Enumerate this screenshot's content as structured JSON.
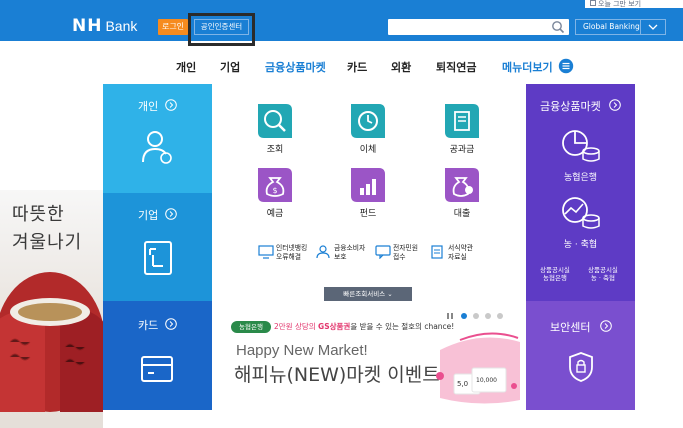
{
  "top_notice": {
    "label": "오늘 그만 보기"
  },
  "header": {
    "logo_nh": "NH",
    "logo_bank": "Bank",
    "login": "로그인",
    "cert_center": "공인인증센터",
    "search_placeholder": "",
    "global": "Global Banking"
  },
  "nav": {
    "items": [
      "개인",
      "기업",
      "금융상품마켓",
      "카드",
      "외환",
      "퇴직연금"
    ],
    "menu_label": "메뉴더보기"
  },
  "promo": {
    "line1": "따뜻한",
    "line2": "겨울나기"
  },
  "left_menu": [
    {
      "label": "개인"
    },
    {
      "label": "기업"
    },
    {
      "label": "카드"
    }
  ],
  "center": {
    "products": [
      {
        "label": "조회",
        "icon": "magnifier-icon"
      },
      {
        "label": "이체",
        "icon": "clock-refresh-icon"
      },
      {
        "label": "공과금",
        "icon": "receipt-icon"
      },
      {
        "label": "예금",
        "icon": "money-bag-icon"
      },
      {
        "label": "펀드",
        "icon": "bar-chart-icon"
      },
      {
        "label": "대출",
        "icon": "coin-bag-icon"
      }
    ],
    "sub_items": [
      {
        "line1": "인터넷뱅킹",
        "line2": "오류해결"
      },
      {
        "line1": "금융소비자",
        "line2": "보호"
      },
      {
        "line1": "전자민원",
        "line2": "접수"
      },
      {
        "line1": "서식약관",
        "line2": "자료실"
      }
    ],
    "quick_service": "빠른조회서비스"
  },
  "banner": {
    "badge": "농협은행",
    "line_prefix": "2만원 상당의 ",
    "line_highlight": "GS상품권",
    "line_suffix": "을 받을 수 있는 절호의 chance!",
    "title_en": "Happy New Market!",
    "title_ko": "해피뉴(NEW)마켓 이벤트",
    "voucher_small": "5,0",
    "voucher_big": "10,000",
    "total_slides": 4,
    "active_slide": 1
  },
  "right_menu": {
    "fin_market": "금융상품마켓",
    "nh_bank": "농협은행",
    "nonghyup": "농 · 축협",
    "sub_left_1": "상품공시실",
    "sub_left_2": "농협은행",
    "sub_right_1": "상품공시실",
    "sub_right_2": "농 · 축협",
    "security": "보안센터"
  },
  "colors": {
    "header_blue": "#1a7fd4",
    "personal": "#2fb2e8",
    "corp": "#1d94d9",
    "card": "#1a66c8",
    "purple_dark": "#5e3bc5",
    "purple_light": "#7a4fcf",
    "teal_icon": "#22a7b4",
    "violet_icon": "#9b55c6",
    "login_orange": "#f68b1f"
  }
}
